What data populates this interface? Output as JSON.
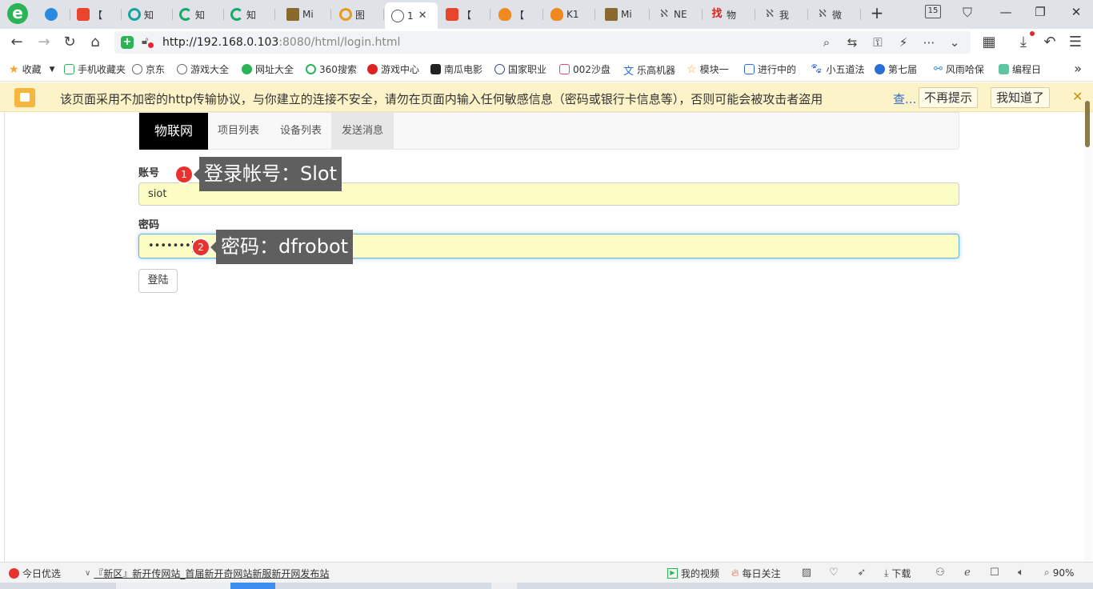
{
  "browser": {
    "tabs": [
      {
        "title": "",
        "icon": "telegram-icon"
      },
      {
        "title": "【",
        "icon": "csdn-icon"
      },
      {
        "title": "知",
        "icon": "zhihu-icon"
      },
      {
        "title": "知",
        "icon": "zhihu-icon"
      },
      {
        "title": "知",
        "icon": "zhihu-icon"
      },
      {
        "title": "Mi",
        "icon": "mind-icon"
      },
      {
        "title": "图",
        "icon": "search-engine-icon"
      },
      {
        "title": "1",
        "icon": "globe-icon",
        "active": true
      },
      {
        "title": "【",
        "icon": "csdn-icon"
      },
      {
        "title": "【",
        "icon": "fox-icon"
      },
      {
        "title": "K1",
        "icon": "fox-icon"
      },
      {
        "title": "Mi",
        "icon": "mind-icon"
      },
      {
        "title": "NE",
        "icon": "net-icon"
      },
      {
        "title": "物",
        "icon": "zhao-icon"
      },
      {
        "title": "我",
        "icon": "net-icon"
      },
      {
        "title": "微",
        "icon": "net-icon"
      }
    ],
    "tab_count": "15",
    "url_host": "http://192.168.0.103",
    "url_rest": ":8080/html/login.html"
  },
  "bookmarks": [
    {
      "label": "收藏",
      "color": "#f5a623"
    },
    {
      "label": "手机收藏夹",
      "color": "#2ab456"
    },
    {
      "label": "京东",
      "color": "#888888"
    },
    {
      "label": "游戏大全",
      "color": "#888888"
    },
    {
      "label": "网址大全",
      "color": "#2ab456"
    },
    {
      "label": "360搜索",
      "color": "#2ab456"
    },
    {
      "label": "游戏中心",
      "color": "#d22222"
    },
    {
      "label": "南瓜电影",
      "color": "#222222"
    },
    {
      "label": "国家职业",
      "color": "#334488"
    },
    {
      "label": "002沙盘",
      "color": "#e24b6a"
    },
    {
      "label": "乐高机器",
      "color": "#2a6fd6"
    },
    {
      "label": "模块一",
      "color": "#f5a623"
    },
    {
      "label": "进行中的",
      "color": "#2a6fd6"
    },
    {
      "label": "小五道法",
      "color": "#3a63c9"
    },
    {
      "label": "第七届",
      "color": "#2a6fd6"
    },
    {
      "label": "风雨哈保",
      "color": "#3a8fd6"
    },
    {
      "label": "编程日",
      "color": "#5cc6a0"
    }
  ],
  "warning": {
    "text": "该页面采用不加密的http传输协议，与你建立的连接不安全，请勿在页面内输入任何敏感信息（密码或银行卡信息等），否则可能会被攻击者盗用",
    "link": "查...",
    "dismiss_label": "不再提示",
    "ack_label": "我知道了"
  },
  "site": {
    "brand": "物联网",
    "nav": [
      "项目列表",
      "设备列表",
      "发送消息"
    ]
  },
  "form": {
    "account_label": "账号",
    "account_value": "siot",
    "password_label": "密码",
    "password_value": "•••••••",
    "login_label": "登陆"
  },
  "annotations": [
    {
      "number": "1",
      "text": "登录帐号：Slot"
    },
    {
      "number": "2",
      "text": "密码：dfrobot"
    }
  ],
  "statusbar": {
    "today_label": "今日优选",
    "news": "『新区』新开传网站_首届新开奇网站新服新开网发布站",
    "video_label": "我的视频",
    "follow_label": "每日关注",
    "download_label": "下载",
    "zoom": "90%"
  }
}
